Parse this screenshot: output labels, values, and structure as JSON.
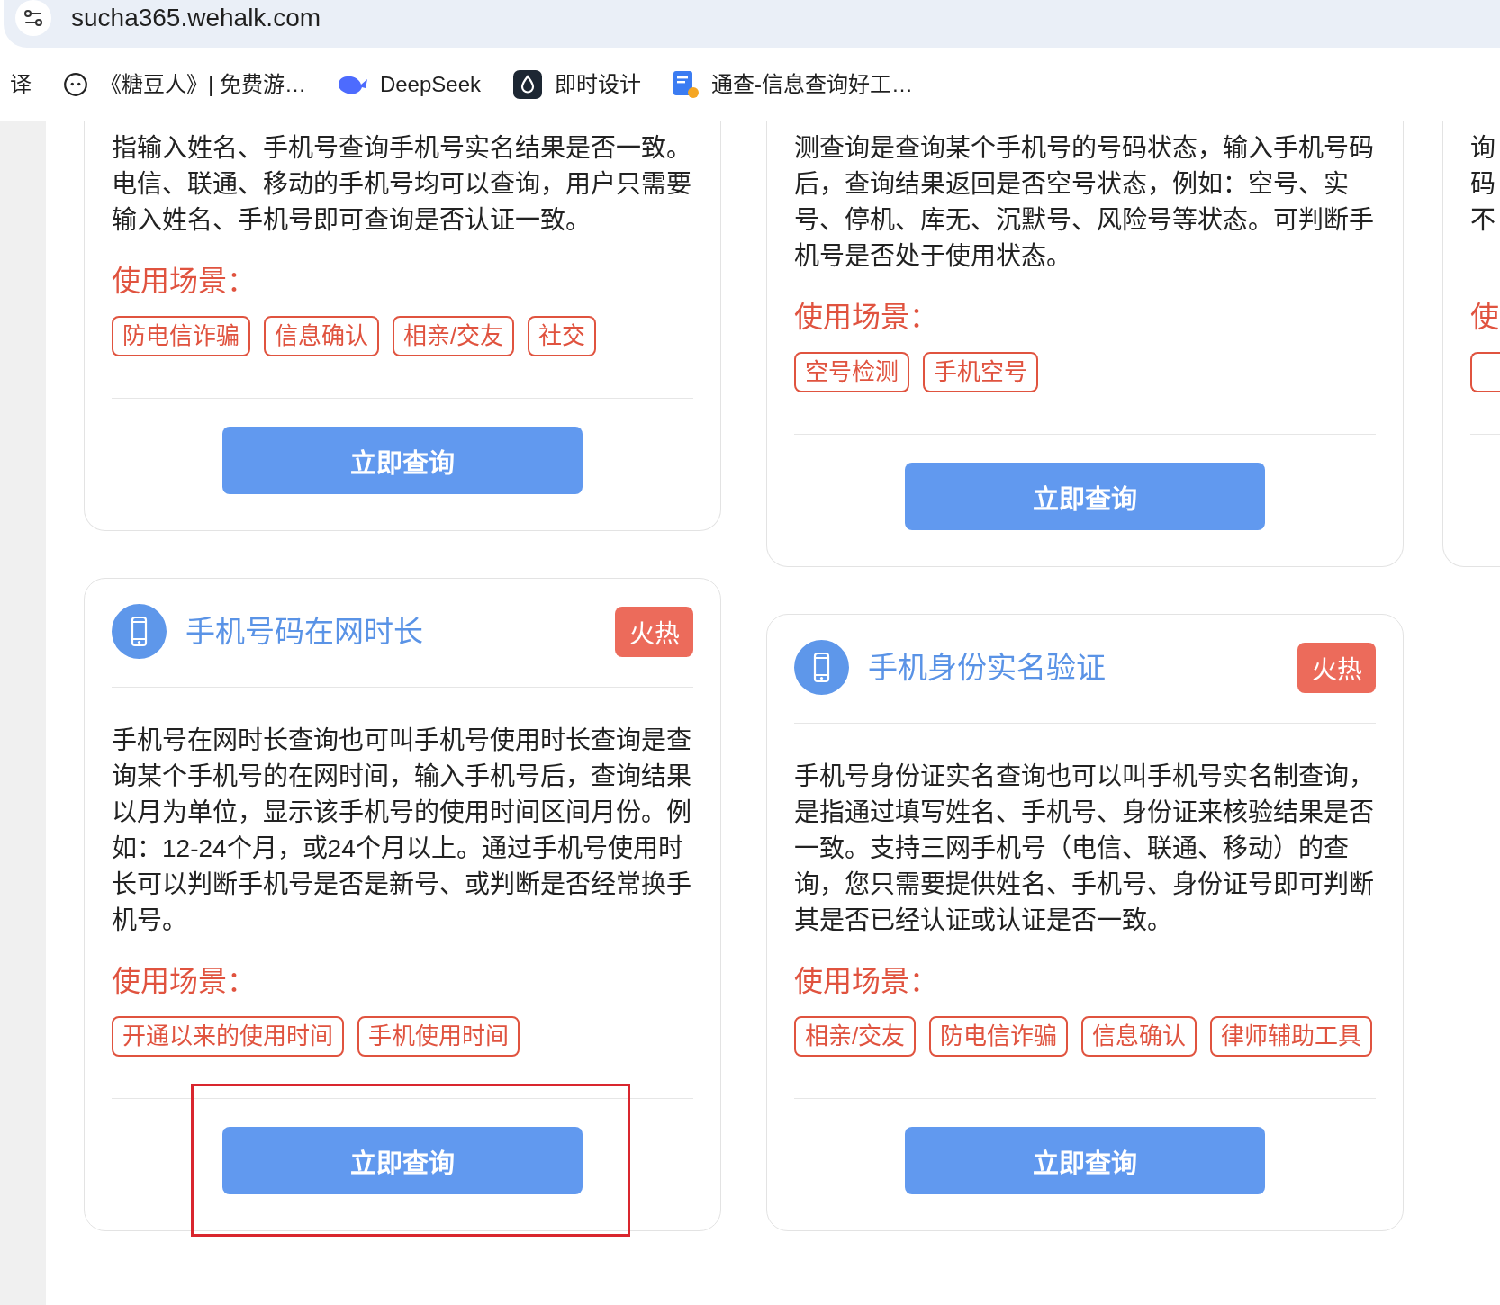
{
  "browser": {
    "url": "sucha365.wehalk.com",
    "bookmarks": [
      {
        "kind": "plain",
        "label": "译"
      },
      {
        "kind": "face",
        "label": "《糖豆人》| 免费游…"
      },
      {
        "kind": "whale",
        "label": "DeepSeek"
      },
      {
        "kind": "tile",
        "label": "即时设计"
      },
      {
        "kind": "doc",
        "label": "通查-信息查询好工…"
      }
    ]
  },
  "columns": [
    {
      "cards": [
        {
          "kind": "top_cut",
          "description": "指输入姓名、手机号查询手机号实名结果是否一致。电信、联通、移动的手机号均可以查询，用户只需要输入姓名、手机号即可查询是否认证一致。",
          "scenario_label": "使用场景：",
          "tags": [
            "防电信诈骗",
            "信息确认",
            "相亲/交友",
            "社交"
          ],
          "button": "立即查询",
          "highlighted": false
        },
        {
          "kind": "full",
          "title": "手机号码在网时长",
          "badge": "火热",
          "description": "手机号在网时长查询也可叫手机号使用时长查询是查询某个手机号的在网时间，输入手机号后，查询结果以月为单位，显示该手机号的使用时间区间月份。例如：12-24个月，或24个月以上。通过手机号使用时长可以判断手机号是否是新号、或判断是否经常换手机号。",
          "scenario_label": "使用场景：",
          "tags": [
            "开通以来的使用时间",
            "手机使用时间"
          ],
          "button": "立即查询",
          "highlighted": true
        }
      ]
    },
    {
      "cards": [
        {
          "kind": "top_cut",
          "description": "测查询是查询某个手机号的号码状态，输入手机号码后，查询结果返回是否空号状态，例如：空号、实号、停机、库无、沉默号、风险号等状态。可判断手机号是否处于使用状态。",
          "scenario_label": "使用场景：",
          "tags": [
            "空号检测",
            "手机空号"
          ],
          "button": "立即查询",
          "highlighted": false
        },
        {
          "kind": "full",
          "title": "手机身份实名验证",
          "badge": "火热",
          "description": "手机号身份证实名查询也可以叫手机号实名制查询，是指通过填写姓名、手机号、身份证来核验结果是否一致。支持三网手机号（电信、联通、移动）的查询，您只需要提供姓名、手机号、身份证号即可判断其是否已经认证或认证是否一致。",
          "scenario_label": "使用场景：",
          "tags": [
            "相亲/交友",
            "防电信诈骗",
            "信息确认",
            "律师辅助工具"
          ],
          "button": "立即查询",
          "highlighted": false
        }
      ]
    },
    {
      "cards": [
        {
          "kind": "edge_cut",
          "description": "询码不",
          "scenario_label": "使"
        }
      ]
    }
  ]
}
